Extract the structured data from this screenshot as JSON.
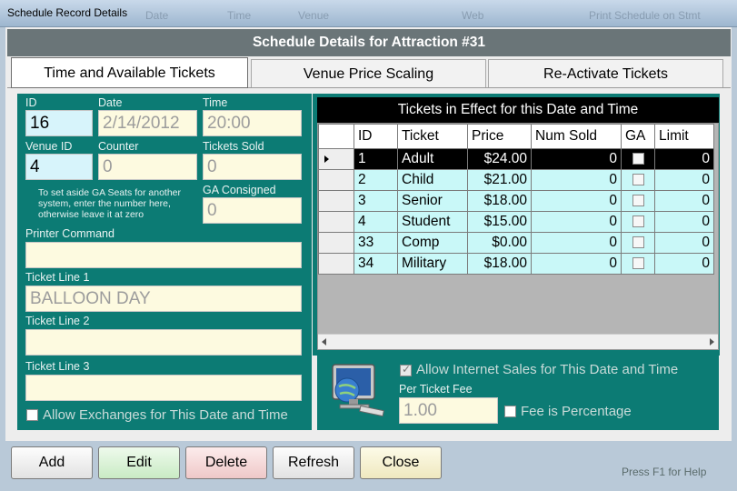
{
  "window": {
    "title": "Schedule Record Details",
    "ghost_text": [
      "Date",
      "Time",
      "Venue",
      "Web",
      "Print Schedule on Stmt"
    ]
  },
  "header": {
    "title": "Schedule Details for Attraction #31"
  },
  "tabs": [
    {
      "label": "Time and Available Tickets",
      "active": true
    },
    {
      "label": "Venue Price Scaling",
      "active": false
    },
    {
      "label": "Re-Activate Tickets",
      "active": false
    }
  ],
  "left": {
    "id": {
      "label": "ID",
      "value": "16"
    },
    "date": {
      "label": "Date",
      "value": "2/14/2012"
    },
    "time": {
      "label": "Time",
      "value": "20:00"
    },
    "venue_id": {
      "label": "Venue ID",
      "value": "4"
    },
    "counter": {
      "label": "Counter",
      "value": "0"
    },
    "tickets_sold": {
      "label": "Tickets Sold",
      "value": "0"
    },
    "ga_note": "To set aside GA Seats for another system, enter the number here, otherwise leave it at zero",
    "ga_consigned": {
      "label": "GA Consigned",
      "value": "0"
    },
    "printer_command": {
      "label": "Printer Command",
      "value": ""
    },
    "ticket_line_1": {
      "label": "Ticket Line 1",
      "value": "BALLOON DAY"
    },
    "ticket_line_2": {
      "label": "Ticket Line 2",
      "value": ""
    },
    "ticket_line_3": {
      "label": "Ticket Line 3",
      "value": ""
    },
    "allow_exchanges": {
      "label": "Allow Exchanges for This Date and Time",
      "checked": false
    }
  },
  "tickets_grid": {
    "title": "Tickets in Effect for this Date and Time",
    "columns": [
      "ID",
      "Ticket",
      "Price",
      "Num Sold",
      "GA",
      "Limit"
    ],
    "rows": [
      {
        "id": "1",
        "ticket": "Adult",
        "price": "$24.00",
        "num_sold": "0",
        "ga": false,
        "limit": "0",
        "selected": true
      },
      {
        "id": "2",
        "ticket": "Child",
        "price": "$21.00",
        "num_sold": "0",
        "ga": false,
        "limit": "0",
        "selected": false
      },
      {
        "id": "3",
        "ticket": "Senior",
        "price": "$18.00",
        "num_sold": "0",
        "ga": false,
        "limit": "0",
        "selected": false
      },
      {
        "id": "4",
        "ticket": "Student",
        "price": "$15.00",
        "num_sold": "0",
        "ga": false,
        "limit": "0",
        "selected": false
      },
      {
        "id": "33",
        "ticket": "Comp",
        "price": "$0.00",
        "num_sold": "0",
        "ga": false,
        "limit": "0",
        "selected": false
      },
      {
        "id": "34",
        "ticket": "Military",
        "price": "$18.00",
        "num_sold": "0",
        "ga": false,
        "limit": "0",
        "selected": false
      }
    ]
  },
  "internet": {
    "allow_internet_sales": {
      "label": "Allow Internet Sales for This Date and Time",
      "checked": true
    },
    "per_ticket_fee": {
      "label": "Per Ticket Fee",
      "value": "1.00"
    },
    "fee_is_percentage": {
      "label": "Fee is Percentage",
      "checked": false
    }
  },
  "buttons": {
    "add": "Add",
    "edit": "Edit",
    "delete": "Delete",
    "refresh": "Refresh",
    "close": "Close"
  },
  "help_text": "Press F1 for Help",
  "colors": {
    "panel_teal": "#0c7b74",
    "header_gray": "#6a7578",
    "grid_row_cyan": "#c9f8f8",
    "field_blue": "#d7f4fb",
    "field_yellow": "#fdfae0",
    "edit_green": "#d9f2d6",
    "delete_pink": "#f6d6d6",
    "close_yellow": "#f8f4d2"
  }
}
